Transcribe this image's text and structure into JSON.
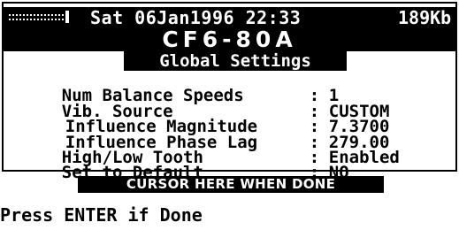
{
  "status_bar": {
    "battery_icon": "battery-icon",
    "datetime": "Sat 06Jan1996 22:33",
    "storage": "189Kb"
  },
  "device_title": "CF6-80A",
  "screen_title": "Global Settings",
  "settings": [
    {
      "label": "Num Balance Speeds",
      "value": "1"
    },
    {
      "label": "Vib. Source",
      "value": "CUSTOM"
    },
    {
      "label": "Influence Magnitude",
      "value": "7.3700"
    },
    {
      "label": "Influence Phase Lag",
      "value": "279.00"
    },
    {
      "label": "High/Low Tooth",
      "value": "Enabled"
    },
    {
      "label": "Set to Default",
      "value": "NO"
    }
  ],
  "separator": ":",
  "done_banner": "CURSOR HERE WHEN DONE",
  "prompt": "Press ENTER if Done",
  "colors": {
    "foreground": "#000000",
    "background": "#ffffff"
  }
}
